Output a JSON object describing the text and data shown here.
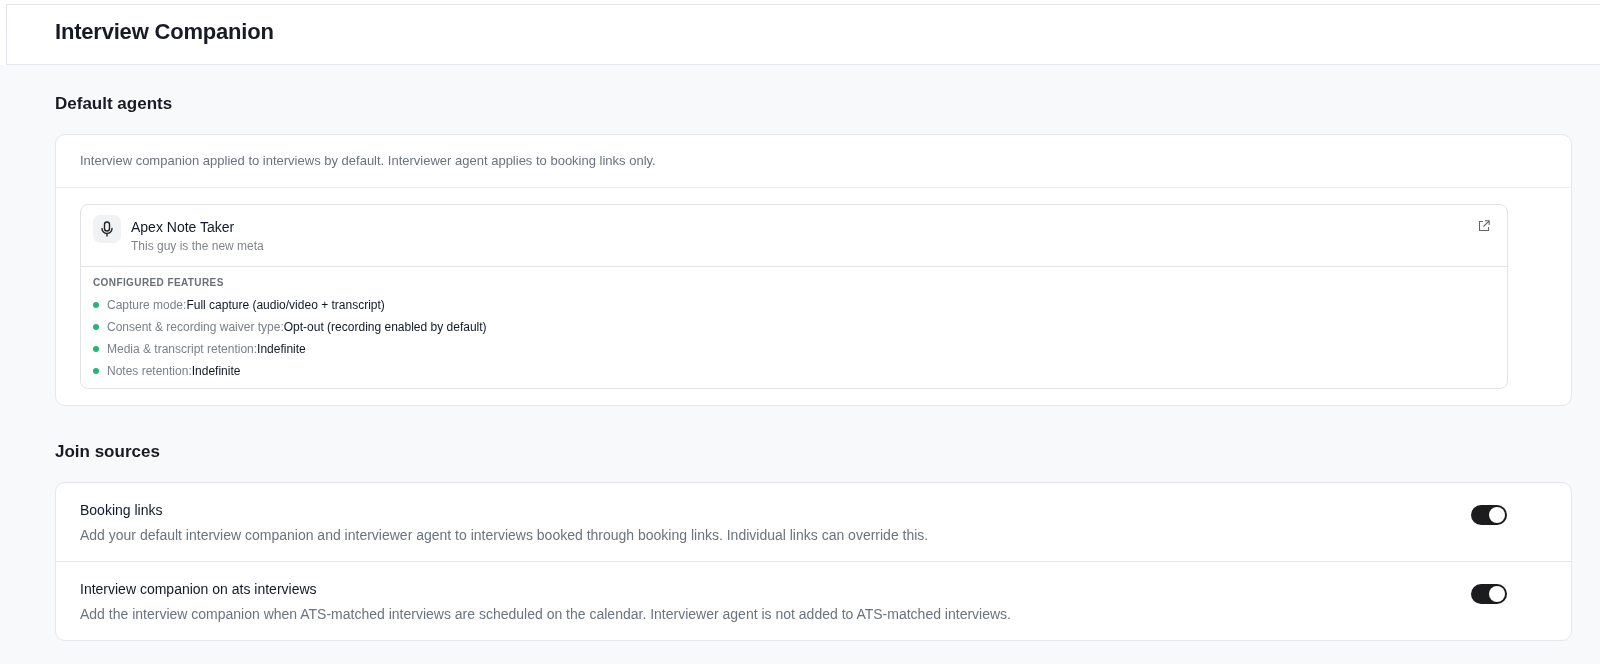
{
  "header": {
    "title": "Interview Companion"
  },
  "default_agents": {
    "heading": "Default agents",
    "description": "Interview companion applied to interviews by default. Interviewer agent applies to booking links only.",
    "agent": {
      "name": "Apex Note Taker",
      "subtitle": "This guy is the new meta",
      "features_heading": "CONFIGURED FEATURES",
      "features": [
        {
          "label": "Capture mode:",
          "value": "Full capture (audio/video + transcript)"
        },
        {
          "label": "Consent & recording waiver type:",
          "value": "Opt-out (recording enabled by default)"
        },
        {
          "label": "Media & transcript retention:",
          "value": "Indefinite"
        },
        {
          "label": "Notes retention:",
          "value": "Indefinite"
        }
      ]
    }
  },
  "join_sources": {
    "heading": "Join sources",
    "items": [
      {
        "title": "Booking links",
        "description": "Add your default interview companion and interviewer agent to interviews booked through booking links. Individual links can override this.",
        "on": true
      },
      {
        "title": "Interview companion on ats interviews",
        "description": "Add the interview companion when ATS-matched interviews are scheduled on the calendar. Interviewer agent is not added to ATS-matched interviews.",
        "on": true
      }
    ]
  }
}
